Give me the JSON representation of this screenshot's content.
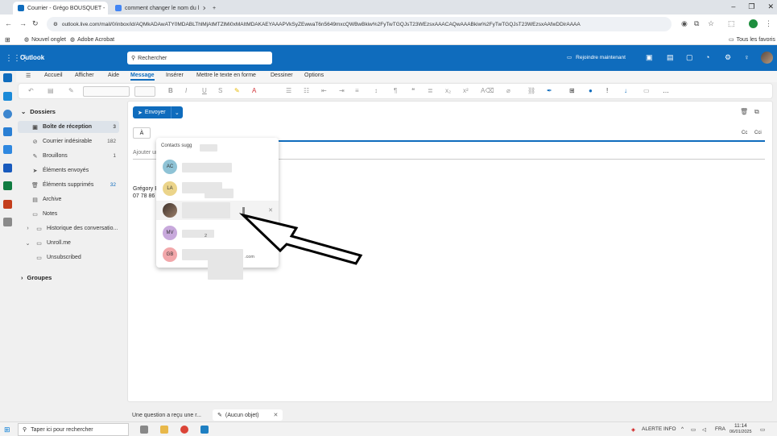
{
  "browser": {
    "tabs": [
      {
        "title": "Courrier - Grégo BOUSQUET - ",
        "active": true,
        "favicon_color": "#0f6cbd"
      },
      {
        "title": "comment changer le nom du l",
        "active": false,
        "favicon_color": "#4285f4"
      }
    ],
    "new_tab": "+",
    "url": "outlook.live.com/mail/0/inbox/id/AQMkADAwATY0MDABLThlMjAtMTZlMi0xMAItMDAKAEYAAAPVkSyZEwwaT6n5649mxcQWBwBkiw%2FyTwTGQJsT23WEzsxAAACAQwAAABkiw%2FyTwTGQJsT23WEzsxAAfwDDirAAAA",
    "bookmarks": {
      "apps_icon": "apps-icon",
      "items": [
        "Nouvel onglet",
        "Adobe Acrobat"
      ],
      "all_favorites": "Tous les favoris"
    }
  },
  "outlook": {
    "brand": "Outlook",
    "search_placeholder": "Rechercher",
    "meeting_label": "Rejoindre maintenant",
    "accent": "#0f6cbd"
  },
  "ribbon": {
    "tabs": [
      "Accueil",
      "Afficher",
      "Aide",
      "Message",
      "Insérer",
      "Mettre le texte en forme",
      "Dessiner",
      "Options"
    ],
    "active_tab": "Message"
  },
  "folders": {
    "section": "Dossiers",
    "items": [
      {
        "label": "Boîte de réception",
        "count": "3",
        "icon": "inbox-icon",
        "selected": true
      },
      {
        "label": "Courrier indésirable",
        "count": "182",
        "icon": "junk-icon"
      },
      {
        "label": "Brouillons",
        "count": "1",
        "icon": "drafts-icon"
      },
      {
        "label": "Éléments envoyés",
        "count": "",
        "icon": "sent-icon"
      },
      {
        "label": "Éléments supprimés",
        "count": "32",
        "icon": "trash-icon"
      },
      {
        "label": "Archive",
        "count": "",
        "icon": "archive-icon"
      },
      {
        "label": "Notes",
        "count": "",
        "icon": "notes-icon"
      },
      {
        "label": "Historique des conversatio...",
        "count": "",
        "icon": "history-icon"
      },
      {
        "label": "Unroll.me",
        "count": "",
        "icon": "folder-icon"
      },
      {
        "label": "Unsubscribed",
        "count": "",
        "icon": "folder-icon"
      }
    ],
    "groups": "Groupes"
  },
  "compose": {
    "send_label": "Envoyer",
    "to_label": "À",
    "cc_label": "Cc",
    "bcc_label": "Cci",
    "subject_placeholder": "Ajouter un",
    "signature_name": "Grégory B",
    "signature_phone": "07 78 86"
  },
  "suggestions": {
    "header": "Contacts sugg",
    "contacts": [
      {
        "initials": "AC",
        "color": "#8fc3d6",
        "extra": ""
      },
      {
        "initials": "LA",
        "color": "#ebd48a",
        "extra": ""
      },
      {
        "initials": "",
        "color": "#6b5a50",
        "extra": ""
      },
      {
        "initials": "MV",
        "color": "#c8a9dc",
        "extra": "2"
      },
      {
        "initials": "GB",
        "color": "#f2a7aa",
        "extra": ".com"
      }
    ]
  },
  "bottom_tabs": {
    "tab1": "Une question a reçu une r...",
    "tab2": "(Aucun objet)"
  },
  "taskbar": {
    "search_placeholder": "Taper ici pour rechercher",
    "alert": "ALERTE INFO",
    "lang": "FRA",
    "time": "11:14",
    "date": "06/01/2025"
  }
}
